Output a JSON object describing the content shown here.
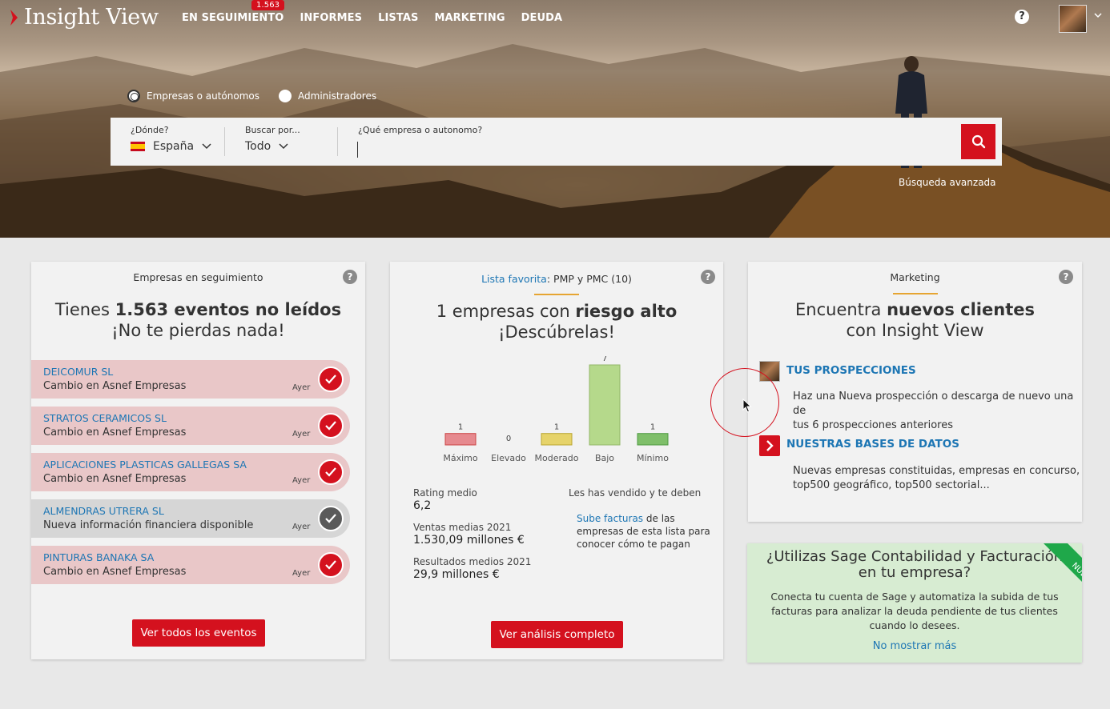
{
  "brand": {
    "name": "Insight View",
    "accent": "#d4111e",
    "link": "#1d76b4"
  },
  "nav": {
    "items": [
      {
        "label": "EN SEGUIMIENTO",
        "badge": "1.563"
      },
      {
        "label": "INFORMES"
      },
      {
        "label": "LISTAS"
      },
      {
        "label": "MARKETING"
      },
      {
        "label": "DEUDA"
      }
    ],
    "help_icon": "?",
    "avatar_icon": "avatar-photo"
  },
  "search": {
    "radios": [
      {
        "label": "Empresas o autónomos",
        "selected": true
      },
      {
        "label": "Administradores",
        "selected": false
      }
    ],
    "where_label": "¿Dónde?",
    "where_value": "España",
    "by_label": "Buscar por...",
    "by_value": "Todo",
    "query_label": "¿Qué empresa o autonomo?",
    "query_value": "",
    "advanced": "Búsqueda avanzada"
  },
  "card1": {
    "title": "Empresas en seguimiento",
    "headline_pre": "Tienes ",
    "headline_bold": "1.563 eventos no leídos",
    "headline_line2": "¡No te pierdas nada!",
    "events": [
      {
        "name": "DEICOMUR SL",
        "desc": "Cambio en Asnef Empresas",
        "when": "Ayer",
        "tone": "red"
      },
      {
        "name": "STRATOS CERAMICOS SL",
        "desc": "Cambio en Asnef Empresas",
        "when": "Ayer",
        "tone": "red"
      },
      {
        "name": "APLICACIONES PLASTICAS GALLEGAS SA",
        "desc": "Cambio en Asnef Empresas",
        "when": "Ayer",
        "tone": "red"
      },
      {
        "name": "ALMENDRAS UTRERA SL",
        "desc": "Nueva información financiera disponible",
        "when": "Ayer",
        "tone": "grey"
      },
      {
        "name": "PINTURAS BANAKA SA",
        "desc": "Cambio en Asnef Empresas",
        "when": "Ayer",
        "tone": "red"
      }
    ],
    "button": "Ver todos los eventos"
  },
  "card2": {
    "title_link": "Lista favorita",
    "title_rest": ": PMP y PMC  (10)",
    "headline_pre": "1 empresas con ",
    "headline_bold": "riesgo alto",
    "headline_line2": "¡Descúbrelas!",
    "stats": [
      {
        "label": "Rating medio",
        "value": "6,2"
      },
      {
        "label": "Ventas medias 2021",
        "value": "1.530,09 millones €"
      },
      {
        "label": "Resultados medios 2021",
        "value": "29,9 millones €"
      }
    ],
    "sold_title": "Les has vendido y te deben",
    "sold_link": "Sube facturas",
    "sold_line1_rest": " de las",
    "sold_line2": "empresas de esta lista para",
    "sold_line3": "conocer cómo te pagan",
    "button": "Ver análisis completo"
  },
  "chart_data": {
    "type": "bar",
    "categories": [
      "Máximo",
      "Elevado",
      "Moderado",
      "Bajo",
      "Mínimo"
    ],
    "values": [
      1,
      0,
      1,
      7,
      1
    ],
    "colors": [
      "#e68a8f",
      "#e0e0e0",
      "#e6d36a",
      "#b5d98b",
      "#7fbf6a"
    ],
    "title": "",
    "xlabel": "",
    "ylabel": "",
    "ylim": [
      0,
      7
    ]
  },
  "card3": {
    "title": "Marketing",
    "headline_pre": "Encuentra ",
    "headline_bold": "nuevos clientes",
    "headline_line2": "con Insight View",
    "items": [
      {
        "title": "TUS PROSPECCIONES",
        "line1": "Haz una Nueva prospección o descarga de nuevo una de",
        "line2": "tus 6 prospecciones anteriores"
      },
      {
        "title": "NUESTRAS BASES DE DATOS",
        "line1": "Nuevas empresas constituidas, empresas en concurso,",
        "line2": "top500 geográfico, top500 sectorial..."
      }
    ]
  },
  "promo": {
    "line1": "¿Utilizas Sage Contabilidad y Facturación",
    "line2": "en tu empresa?",
    "text1": "Conecta tu cuenta de Sage y automatiza la subida de tus",
    "text2": "facturas para analizar la deuda pendiente de tus clientes",
    "text3": "cuando lo desees.",
    "link": "No mostrar más",
    "ribbon": "NUEVO"
  }
}
